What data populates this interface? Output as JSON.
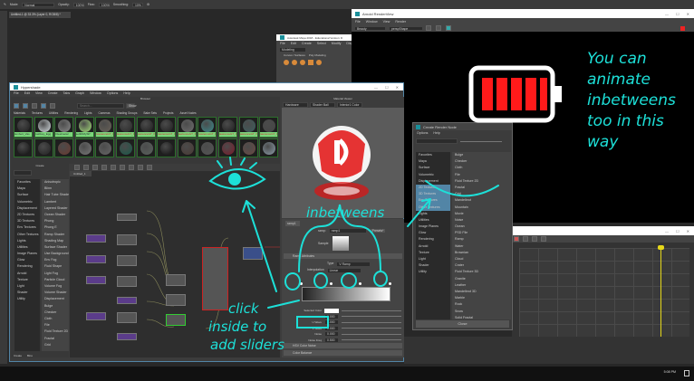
{
  "photoshop": {
    "options": {
      "mode_label": "Mode:",
      "mode_value": "Normal",
      "opacity_label": "Opacity:",
      "opacity_value": "100%",
      "flow_label": "Flow:",
      "flow_value": "100%",
      "smoothing_label": "Smoothing:",
      "smoothing_value": "10%"
    },
    "doc_tab": "Untitled-1 @ 33.3% (Layer 0, RGB/8) *"
  },
  "maya_main": {
    "title": "Autodesk Maya 2018 - Educational Version: D",
    "menu": [
      "File",
      "Edit",
      "Create",
      "Select",
      "Modify",
      "Display"
    ],
    "workspace": "Modeling",
    "shelf_tabs": [
      "Curves / Surfaces",
      "Poly Modeling"
    ]
  },
  "arnold": {
    "title": "Arnold RenderView",
    "menu": [
      "File",
      "Window",
      "View",
      "Render"
    ],
    "camera": "Beauty",
    "shape": "perspShape"
  },
  "hypershade": {
    "title": "Hypershade",
    "menu": [
      "File",
      "Edit",
      "View",
      "Create",
      "Tabs",
      "Graph",
      "Window",
      "Options",
      "Help"
    ],
    "browser_label": "Browser",
    "search_placeholder": "Search...",
    "show_label": "Show",
    "tabs": [
      "Materials",
      "Textures",
      "Utilities",
      "Rendering",
      "Lights",
      "Cameras",
      "Shading Groups",
      "Bake Sets",
      "Projects",
      "Asset Nodes"
    ],
    "swatch_labels": [
      "lambert_Vas",
      "Gabbey_Egg",
      "Dieelmetal",
      "sel3DMySP",
      "lawrenceGT_P",
      "lawrenceGT_P",
      "lawrenceGT_P",
      "lawrenceGT_P",
      "lawrenceGT_P",
      "lawrenceGT_P",
      "lawrenceGT_P",
      "lawrenceGT_P",
      "lawrenceGT_P"
    ],
    "create_label": "Create",
    "create_tree": [
      "Favorites",
      "Maya",
      "Surface",
      "Volumetric",
      "Displacement",
      "2D Textures",
      "3D Textures",
      "Env Textures",
      "Other Textures",
      "Lights",
      "Utilities",
      "Image Planes",
      "Glow",
      "Rendering",
      "Arnold",
      "Texture",
      "Light",
      "Shader",
      "Utility"
    ],
    "create_nodes": [
      "Anisotropic",
      "Blinn",
      "Hair Tube Shader",
      "Lambert",
      "Layered Shader",
      "Ocean Shader",
      "Phong",
      "Phong E",
      "Ramp Shader",
      "Shading Map",
      "Surface Shader",
      "Use Background",
      "Env Fog",
      "Fluid Shape",
      "Light Fog",
      "Particle Cloud",
      "Volume Fog",
      "Volume Shader",
      "Displacement",
      "Bulge",
      "Checker",
      "Cloth",
      "File",
      "Fluid Texture 2D",
      "Fractal",
      "Grid"
    ],
    "bottom_tabs": [
      "Create",
      "Bins"
    ],
    "node_editor_tab": "Untitled_1",
    "material_viewer": {
      "label": "Material Viewer",
      "renderer": "Hardware",
      "shape": "Shader Ball",
      "env": "Interior1 Color"
    },
    "attr": {
      "tab": "ramp1",
      "ramp_label": "ramp:",
      "ramp_value": "ramp1",
      "presets": "Presets*",
      "sample_label": "Sample",
      "section": "Ramp Attributes",
      "type_label": "Type",
      "type_value": "V Ramp",
      "interp_label": "Interpolation",
      "interp_value": "Linear",
      "selected_color": "Selected Color",
      "selected_position": "Selected Position",
      "selected_position_value": "0.000",
      "u_wave": "U Wave",
      "u_wave_value": "0.000",
      "v_wave": "V Wave",
      "v_wave_value": "0.000",
      "noise": "Noise",
      "noise_value": "0.000",
      "noise_freq": "Noise Freq",
      "noise_freq_value": "0.500",
      "hsv": "HSV Color Noise",
      "color_balance": "Color Balance"
    }
  },
  "create_render_node": {
    "title": "Create Render Node",
    "menu": [
      "Options",
      "Help"
    ],
    "tree": [
      "Favorites",
      "Maya",
      "Surface",
      "Volumetric",
      "Displacement",
      "2D Textures",
      "3D Textures",
      "Env Textures",
      "Other Textures",
      "Lights",
      "Utilities",
      "Image Planes",
      "Glow",
      "Rendering",
      "Arnold",
      "Texture",
      "Light",
      "Shader",
      "Utility"
    ],
    "nodes": [
      "Bulge",
      "Checker",
      "Cloth",
      "File",
      "Fluid Texture 2D",
      "Fractal",
      "Grid",
      "Mandelbrot",
      "Mountain",
      "Movie",
      "Noise",
      "Ocean",
      "PSD File",
      "Ramp",
      "Water",
      "Brownian",
      "Cloud",
      "Crater",
      "Fluid Texture 3D",
      "Granite",
      "Leather",
      "Mandelbrot 3D",
      "Marble",
      "Rock",
      "Snow",
      "Solid Fractal"
    ],
    "close_label": "Close"
  },
  "taskbar": {
    "time": "5:08 PM"
  },
  "annotations": {
    "animate_note": [
      "You can",
      "animate",
      "inbetweens",
      "too in this",
      "way"
    ],
    "inbetweens_label": "inbetweens",
    "click_note": [
      "click",
      "inside to",
      "add sliders"
    ]
  },
  "colors": {
    "annotation": "#1de0d8",
    "battery": "#ff1a1a",
    "selection": "#5285a6",
    "playhead": "#e6d81a"
  }
}
